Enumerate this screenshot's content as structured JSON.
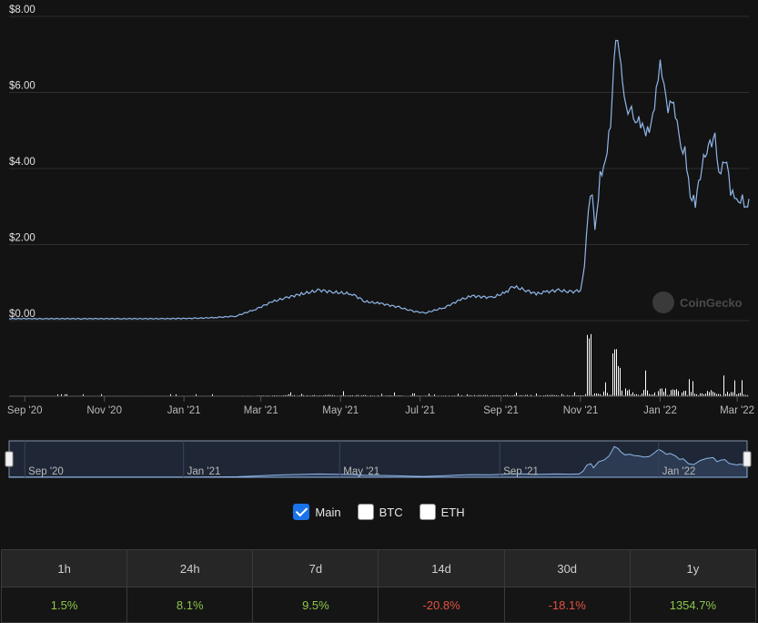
{
  "watermark": "CoinGecko",
  "colors": {
    "line": "#8fb6e8",
    "volume": "#ffffff",
    "navigator_fill": "#2c3a52",
    "grid": "#2e2e2e",
    "positive": "#8dc647",
    "negative": "#e15241",
    "checkbox_checked": "#1a73e8"
  },
  "chart_data": {
    "type": "line",
    "title": "",
    "y_axis": {
      "ticks": [
        "$0.00",
        "$2.00",
        "$4.00",
        "$6.00",
        "$8.00"
      ],
      "range": [
        0,
        8
      ]
    },
    "x_axis": {
      "ticks": [
        "Sep '20",
        "Nov '20",
        "Jan '21",
        "Mar '21",
        "May '21",
        "Jul '21",
        "Sep '21",
        "Nov '21",
        "Jan '22",
        "Mar '22"
      ],
      "range": [
        "2020-08-20",
        "2022-03-10"
      ]
    },
    "navigator_ticks": [
      "Sep '20",
      "Jan '21",
      "May '21",
      "Sep '21",
      "Jan '22"
    ],
    "series": [
      {
        "values_x": [
          "2020-08-20",
          "2020-09-15",
          "2020-10-15",
          "2020-11-15",
          "2020-12-15",
          "2021-01-10",
          "2021-01-25",
          "2021-02-10",
          "2021-02-25",
          "2021-03-10",
          "2021-03-20",
          "2021-04-01",
          "2021-04-15",
          "2021-04-25",
          "2021-05-10",
          "2021-05-20",
          "2021-06-01",
          "2021-06-15",
          "2021-06-25",
          "2021-07-05",
          "2021-07-20",
          "2021-08-01",
          "2021-08-10",
          "2021-08-25",
          "2021-09-05",
          "2021-09-10",
          "2021-09-20",
          "2021-09-28",
          "2021-10-05",
          "2021-10-15",
          "2021-10-25",
          "2021-11-01",
          "2021-11-04",
          "2021-11-07",
          "2021-11-10",
          "2021-11-12",
          "2021-11-16",
          "2021-11-20",
          "2021-11-24",
          "2021-11-28",
          "2021-12-01",
          "2021-12-03",
          "2021-12-06",
          "2021-12-10",
          "2021-12-13",
          "2021-12-17",
          "2021-12-21",
          "2021-12-25",
          "2021-12-29",
          "2022-01-01",
          "2022-01-04",
          "2022-01-07",
          "2022-01-10",
          "2022-01-14",
          "2022-01-17",
          "2022-01-20",
          "2022-01-24",
          "2022-01-28",
          "2022-02-02",
          "2022-02-07",
          "2022-02-12",
          "2022-02-15",
          "2022-02-18",
          "2022-02-21",
          "2022-02-24",
          "2022-02-27",
          "2022-03-02",
          "2022-03-05",
          "2022-03-08",
          "2022-03-10"
        ],
        "values_y": [
          0.05,
          0.05,
          0.05,
          0.05,
          0.05,
          0.06,
          0.08,
          0.12,
          0.3,
          0.5,
          0.6,
          0.7,
          0.8,
          0.75,
          0.7,
          0.5,
          0.45,
          0.35,
          0.25,
          0.2,
          0.35,
          0.55,
          0.65,
          0.6,
          0.75,
          0.9,
          0.8,
          0.7,
          0.75,
          0.8,
          0.75,
          0.8,
          1.5,
          3.0,
          3.3,
          2.3,
          3.8,
          4.2,
          5.2,
          7.5,
          7.0,
          6.2,
          5.5,
          5.6,
          5.3,
          5.2,
          4.9,
          5.1,
          6.0,
          6.8,
          6.3,
          5.6,
          5.8,
          5.2,
          4.4,
          4.5,
          3.3,
          3.1,
          4.1,
          4.6,
          4.8,
          3.8,
          4.2,
          4.3,
          3.4,
          3.2,
          3.0,
          3.2,
          3.0,
          3.2
        ]
      }
    ],
    "volume_note": "relative volume bars"
  },
  "legend": [
    {
      "label": "Main",
      "checked": true
    },
    {
      "label": "BTC",
      "checked": false
    },
    {
      "label": "ETH",
      "checked": false
    }
  ],
  "performance": {
    "headers": [
      "1h",
      "24h",
      "7d",
      "14d",
      "30d",
      "1y"
    ],
    "values": [
      "1.5%",
      "8.1%",
      "9.5%",
      "-20.8%",
      "-18.1%",
      "1354.7%"
    ]
  }
}
